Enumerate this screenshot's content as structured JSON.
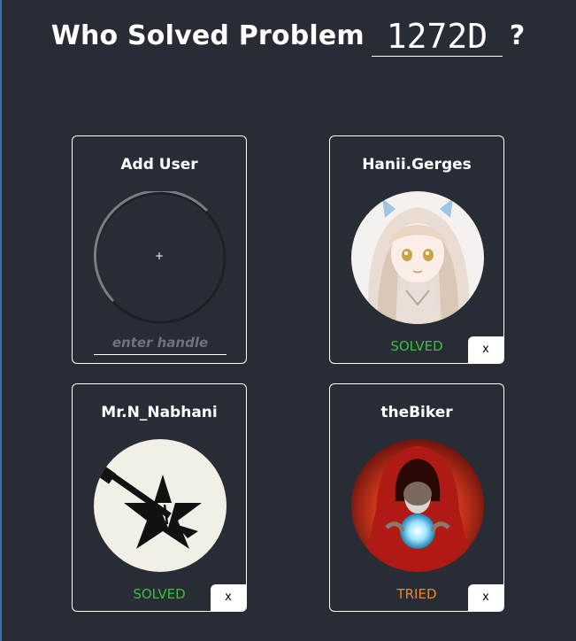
{
  "header": {
    "title": "Who Solved Problem",
    "problem_value": "1272D",
    "question_mark": "?"
  },
  "add_card": {
    "title": "Add User",
    "plus": "+",
    "handle_placeholder": "enter handle"
  },
  "users": [
    {
      "handle": "Hanii.Gerges",
      "status": "SOLVED",
      "status_color": "#3fbf3f",
      "remove": "x",
      "avatar": "anime-girl-avatar"
    },
    {
      "handle": "Mr.N_Nabhani",
      "status": "SOLVED",
      "status_color": "#3fbf3f",
      "remove": "x",
      "avatar": "star-sword-emblem-avatar"
    },
    {
      "handle": "theBiker",
      "status": "TRIED",
      "status_color": "#e8892a",
      "remove": "x",
      "avatar": "hooded-wizard-avatar"
    }
  ],
  "colors": {
    "background": "#282c34",
    "card_border": "#ffffff",
    "solved": "#3fbf3f",
    "tried": "#e8892a"
  }
}
